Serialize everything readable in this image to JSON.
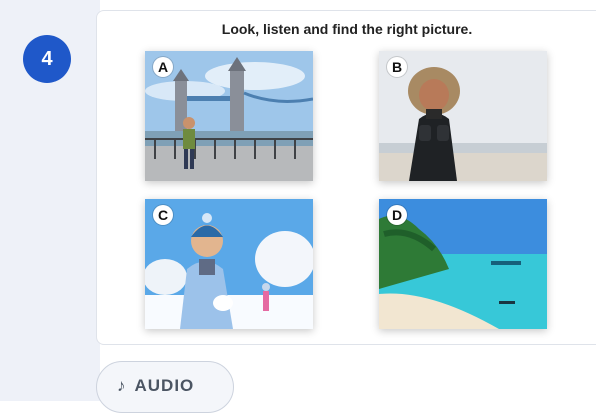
{
  "exercise": {
    "number": "4",
    "instruction": "Look, listen and find the right picture."
  },
  "pictures": [
    {
      "letter": "A",
      "icon": "london-bridge-photo"
    },
    {
      "letter": "B",
      "icon": "winter-beach-photo"
    },
    {
      "letter": "C",
      "icon": "snow-boy-photo"
    },
    {
      "letter": "D",
      "icon": "tropical-beach-photo"
    }
  ],
  "audio": {
    "icon_glyph": "♪",
    "label": "AUDIO"
  }
}
